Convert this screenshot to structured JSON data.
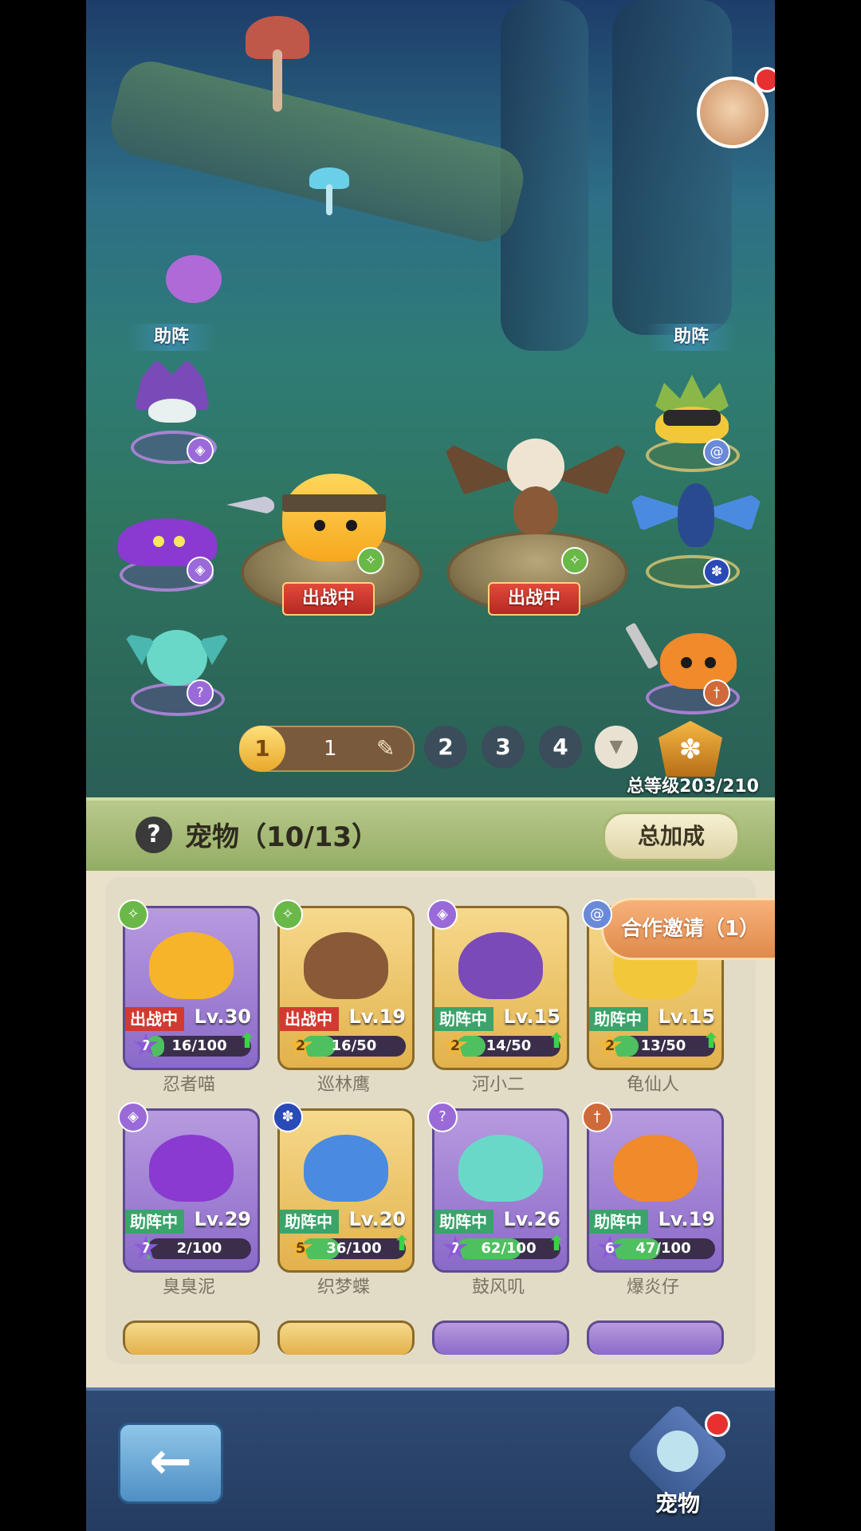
{
  "scene": {
    "assist_left_label": "助阵",
    "assist_right_label": "助阵",
    "fighting_badge": "出战中",
    "team_tabs": [
      {
        "number": "1",
        "sub_label": "1",
        "active": true
      },
      {
        "number": "2"
      },
      {
        "number": "3"
      },
      {
        "number": "4"
      }
    ],
    "total_level": "总等级203/210"
  },
  "panel": {
    "title": "宠物（10/13）",
    "help_icon": "?",
    "total_bonus_button": "总加成",
    "coop_invite": "合作邀请（1）",
    "pets": [
      {
        "name": "忍者喵",
        "status": "出战中",
        "level": "Lv.30",
        "stars": "7",
        "exp": "16/100",
        "exp_fraction": 0.16,
        "card": "purple",
        "can_upgrade": true
      },
      {
        "name": "巡林鹰",
        "status": "出战中",
        "level": "Lv.19",
        "stars": "2",
        "exp": "16/50",
        "exp_fraction": 0.32,
        "card": "gold",
        "can_upgrade": false
      },
      {
        "name": "河小二",
        "status": "助阵中",
        "level": "Lv.15",
        "stars": "2",
        "exp": "14/50",
        "exp_fraction": 0.28,
        "card": "gold",
        "can_upgrade": true
      },
      {
        "name": "龟仙人",
        "status": "助阵中",
        "level": "Lv.15",
        "stars": "2",
        "exp": "13/50",
        "exp_fraction": 0.26,
        "card": "gold",
        "can_upgrade": true
      },
      {
        "name": "臭臭泥",
        "status": "助阵中",
        "level": "Lv.29",
        "stars": "7",
        "exp": "2/100",
        "exp_fraction": 0.02,
        "card": "purple",
        "can_upgrade": false
      },
      {
        "name": "织梦蝶",
        "status": "助阵中",
        "level": "Lv.20",
        "stars": "5",
        "exp": "36/100",
        "exp_fraction": 0.36,
        "card": "gold",
        "can_upgrade": true
      },
      {
        "name": "鼓风叽",
        "status": "助阵中",
        "level": "Lv.26",
        "stars": "7",
        "exp": "62/100",
        "exp_fraction": 0.62,
        "card": "purple",
        "can_upgrade": true
      },
      {
        "name": "爆炎仔",
        "status": "助阵中",
        "level": "Lv.19",
        "stars": "6",
        "exp": "47/100",
        "exp_fraction": 0.47,
        "card": "purple",
        "can_upgrade": false
      }
    ]
  },
  "bottom": {
    "back_icon": "left-arrow-icon",
    "pet_tab_label": "宠物"
  },
  "colors": {
    "fight_status": "#d23a30",
    "assist_status": "#3aa46a",
    "exp_fill": "#4fc060",
    "notification": "#e83030"
  }
}
